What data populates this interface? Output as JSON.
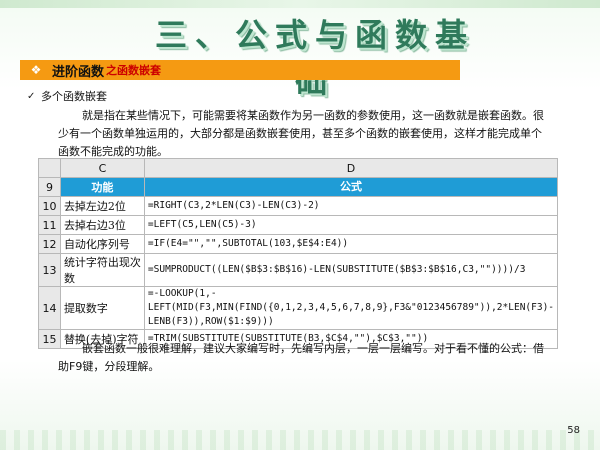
{
  "title": "三、公式与函数基础",
  "section_bar": {
    "icon": "diamond-bullet-icon",
    "main": "进阶函数",
    "sub": "之函数嵌套"
  },
  "bullet": {
    "icon": "check-icon",
    "text": "多个函数嵌套"
  },
  "paragraph1": "就是指在某些情况下，可能需要将某函数作为另一函数的参数使用，这一函数就是嵌套函数。很少有一个函数单独运用的，大部分都是函数嵌套使用，甚至多个函数的嵌套使用，这样才能完成单个函数不能完成的功能。",
  "table": {
    "col_letters": [
      "C",
      "D"
    ],
    "header": {
      "row": "9",
      "c": "功能",
      "d": "公式"
    },
    "rows": [
      {
        "row": "10",
        "c": "去掉左边2位",
        "d": "=RIGHT(C3,2*LEN(C3)-LEN(C3)-2)"
      },
      {
        "row": "11",
        "c": "去掉右边3位",
        "d": "=LEFT(C5,LEN(C5)-3)"
      },
      {
        "row": "12",
        "c": "自动化序列号",
        "d": "=IF(E4=\"\",\"\",SUBTOTAL(103,$E$4:E4))"
      },
      {
        "row": "13",
        "c": "统计字符出现次数",
        "d": "=SUMPRODUCT((LEN($B$3:$B$16)-LEN(SUBSTITUTE($B$3:$B$16,C3,\"\"))))/3"
      },
      {
        "row": "14",
        "c": "提取数字",
        "d": "=-LOOKUP(1,-LEFT(MID(F3,MIN(FIND({0,1,2,3,4,5,6,7,8,9},F3&\"0123456789\")),2*LEN(F3)-LENB(F3)),ROW($1:$9)))"
      },
      {
        "row": "15",
        "c": "替换(去掉)字符",
        "d": "=TRIM(SUBSTITUTE(SUBSTITUTE(B3,$C$4,\"\"),$C$3,\"\"))"
      }
    ]
  },
  "paragraph2": "嵌套函数一般很难理解，建议大家编写时，先编写内层，一层一层编写。对于看不懂的公式：借助F9键，分段理解。",
  "page_number": "58"
}
